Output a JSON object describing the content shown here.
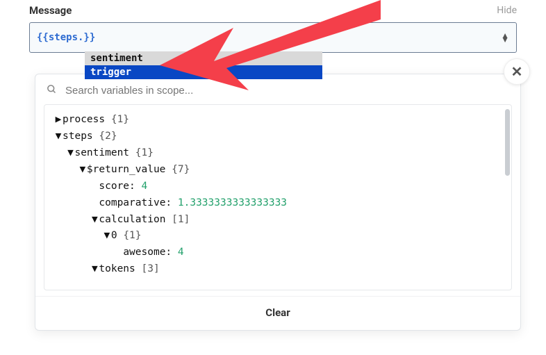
{
  "header": {
    "label": "Message",
    "hide": "Hide"
  },
  "input": {
    "value": "{{steps.}}"
  },
  "autocomplete": {
    "items": [
      {
        "label": "sentiment",
        "selected": false
      },
      {
        "label": "trigger",
        "selected": true
      }
    ]
  },
  "popup": {
    "search_placeholder": "Search variables in scope...",
    "clear_label": "Clear"
  },
  "tree": {
    "rows": [
      {
        "indent": 0,
        "caret": "▶",
        "key": "process",
        "meta": "{1}"
      },
      {
        "indent": 0,
        "caret": "▼",
        "key": "steps",
        "meta": "{2}"
      },
      {
        "indent": 1,
        "caret": "▼",
        "key": "sentiment",
        "meta": "{1}"
      },
      {
        "indent": 2,
        "caret": "▼",
        "key": "$return_value",
        "meta": "{7}"
      },
      {
        "indent": 3,
        "caret": "",
        "key": "score:",
        "value": "4"
      },
      {
        "indent": 3,
        "caret": "",
        "key": "comparative:",
        "value": "1.3333333333333333"
      },
      {
        "indent": 3,
        "caret": "▼",
        "key": "calculation",
        "meta": "[1]"
      },
      {
        "indent": 4,
        "caret": "▼",
        "key": "0",
        "meta": "{1}"
      },
      {
        "indent": 5,
        "caret": "",
        "key": "awesome:",
        "value": "4"
      },
      {
        "indent": 3,
        "caret": "▼",
        "key": "tokens",
        "meta": "[3]"
      }
    ]
  }
}
